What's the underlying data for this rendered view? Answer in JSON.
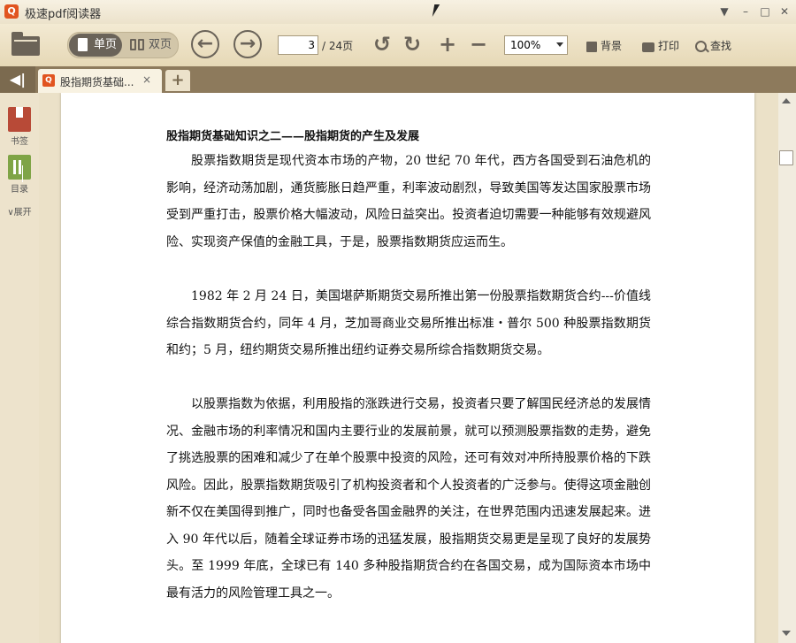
{
  "window": {
    "title": "极速pdf阅读器",
    "controls": [
      "▼",
      "–",
      "□",
      "✕"
    ]
  },
  "toolbar": {
    "single_label": "单页",
    "double_label": "双页",
    "back_glyph": "←",
    "forward_glyph": "→",
    "page_current": "3",
    "page_total": "/ 24页",
    "zoom_value": "100%",
    "background_label": "背景",
    "print_label": "打印",
    "find_label": "查找"
  },
  "tabs": [
    {
      "label": "股指期货基础...",
      "close": "×"
    }
  ],
  "new_tab_label": "+",
  "sidebar": {
    "bookmark_label": "书签",
    "toc_label": "目录",
    "expand_label": "展开"
  },
  "document": {
    "heading": "股指期货基础知识之二——股指期货的产生及发展",
    "paragraphs": [
      "股票指数期货是现代资本市场的产物，20 世纪 70 年代，西方各国受到石油危机的影响，经济动荡加剧，通货膨胀日趋严重，利率波动剧烈，导致美国等发达国家股票市场受到严重打击，股票价格大幅波动，风险日益突出。投资者迫切需要一种能够有效规避风险、实现资产保值的金融工具，于是，股票指数期货应运而生。",
      "1982 年 2 月 24 日，美国堪萨斯期货交易所推出第一份股票指数期货合约---价值线综合指数期货合约，同年 4 月，芝加哥商业交易所推出标准・普尔 500 种股票指数期货和约；5 月，纽约期货交易所推出纽约证券交易所综合指数期货交易。",
      "以股票指数为依据，利用股指的涨跌进行交易，投资者只要了解国民经济总的发展情况、金融市场的利率情况和国内主要行业的发展前景，就可以预测股票指数的走势，避免了挑选股票的困难和减少了在单个股票中投资的风险，还可有效对冲所持股票价格的下跌风险。因此，股票指数期货吸引了机构投资者和个人投资者的广泛参与。使得这项金融创新不仅在美国得到推广，同时也备受各国金融界的关注，在世界范围内迅速发展起来。进入 90 年代以后，随着全球证券市场的迅猛发展，股指期货交易更是呈现了良好的发展势头。至 1999 年底，全球已有 140 多种股指期货合约在各国交易，成为国际资本市场中最有活力的风险管理工具之一。"
    ]
  }
}
